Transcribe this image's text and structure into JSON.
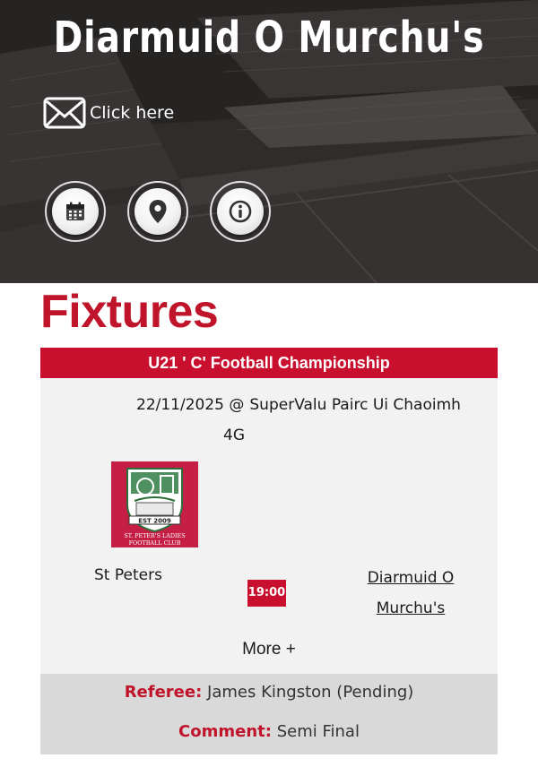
{
  "header": {
    "club_name": "Diarmuid O Murchu's",
    "contact_label": "Click here",
    "icons": [
      "envelope-icon",
      "calendar-icon",
      "location-pin-icon",
      "info-icon"
    ]
  },
  "fixtures": {
    "title": "Fixtures",
    "competition": "U21 ' C' Football Championship",
    "date": "22/11/2025 @",
    "venue": "SuperValu Pairc Ui Chaoimh",
    "venue_extra": "4G",
    "home_team": "St Peters",
    "home_crest": {
      "est": "EST 2009",
      "club_text_1": "ST. PETER'S LADIES",
      "club_text_2": "FOOTBALL CLUB"
    },
    "time": "19:00",
    "away_team": "Diarmuid O Murchu's",
    "more_label": "More +",
    "referee_label": "Referee:",
    "referee_value": "James Kingston (Pending)",
    "comment_label": "Comment:",
    "comment_value": "Semi Final"
  },
  "colors": {
    "accent_red": "#c8102e",
    "card_bg": "#f2f2f2",
    "footer_bg": "#d9d9d9",
    "hero_bg": "#3a3535"
  }
}
